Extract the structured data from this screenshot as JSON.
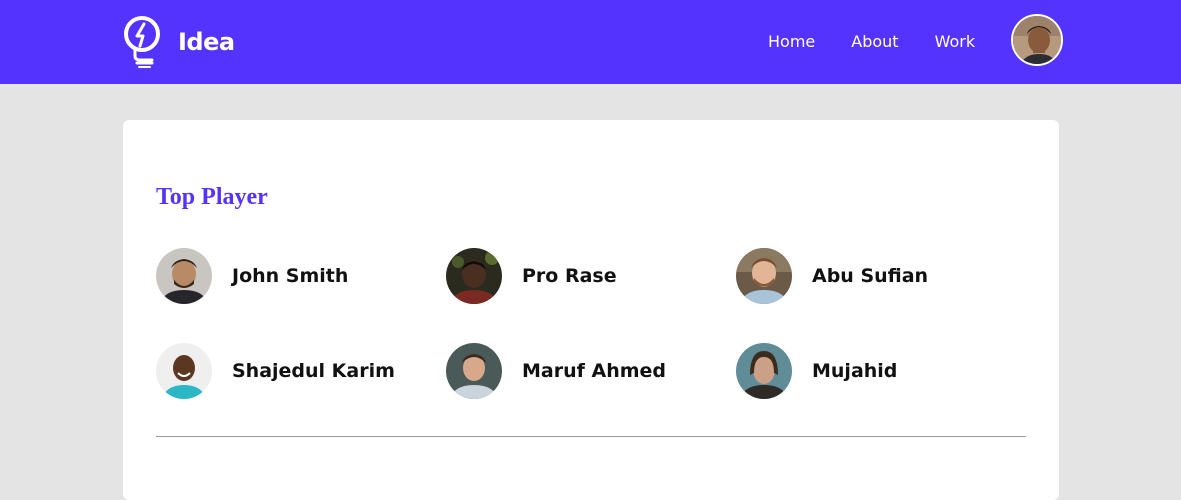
{
  "navbar": {
    "brand": "Idea",
    "brand_color": "#5433ff",
    "links": [
      {
        "label": "Home"
      },
      {
        "label": "About"
      },
      {
        "label": "Work"
      }
    ]
  },
  "main": {
    "title": "Top Player",
    "players": [
      {
        "name": "John Smith"
      },
      {
        "name": "Pro Rase"
      },
      {
        "name": "Abu Sufian"
      },
      {
        "name": "Shajedul Karim"
      },
      {
        "name": "Maruf Ahmed"
      },
      {
        "name": "Mujahid"
      }
    ]
  }
}
